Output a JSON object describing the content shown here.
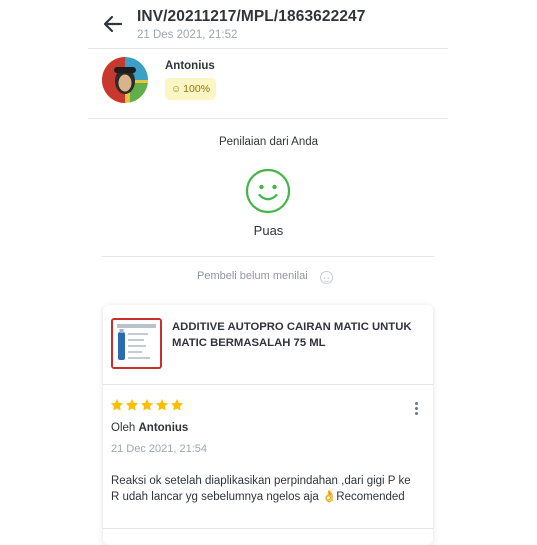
{
  "header": {
    "invoice": "INV/20211217/MPL/1863622247",
    "date": "21 Des 2021, 21:52"
  },
  "seller": {
    "name": "Antonius",
    "badge_icon": "smile-face-icon",
    "badge_value": "100%"
  },
  "rating": {
    "label": "Penilaian dari Anda",
    "result": "Puas",
    "buyer_status": "Pembeli belum menilai"
  },
  "product": {
    "name": "ADDITIVE AUTOPRO CAIRAN MATIC UNTUK MATIC BERMASALAH 75 ML"
  },
  "review": {
    "stars": 5,
    "by_prefix": "Oleh",
    "author": "Antonius",
    "date": "21 Dec 2021, 21:54",
    "text": "Reaksi ok setelah diaplikasikan perpindahan ,dari gigi P ke R udah lancar yg sebelumnya ngelos aja 👌Recomended"
  },
  "colors": {
    "accent_green": "#42b549",
    "star_yellow": "#fac000",
    "badge_bg": "#fcf5c4",
    "product_border": "#c9302c"
  }
}
